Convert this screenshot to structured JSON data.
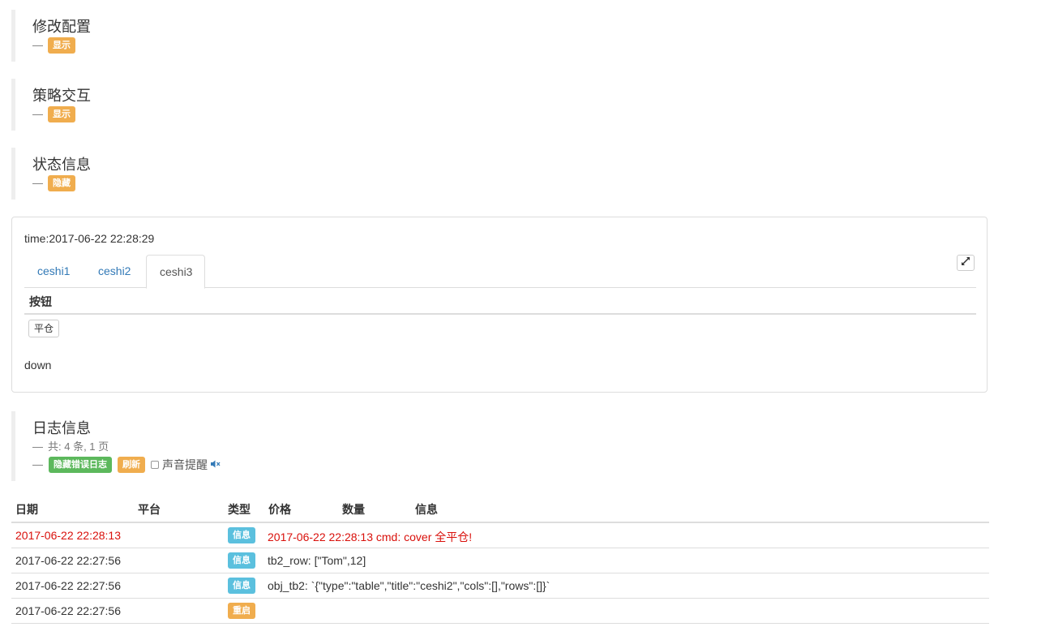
{
  "sections": {
    "modify_config": {
      "title": "修改配置",
      "dash": "—",
      "toggle": "显示"
    },
    "strategy_interaction": {
      "title": "策略交互",
      "dash": "—",
      "toggle": "显示"
    },
    "status_info": {
      "title": "状态信息",
      "dash": "—",
      "toggle": "隐藏"
    }
  },
  "status_panel": {
    "time_text": "time:2017-06-22 22:28:29",
    "tabs": [
      {
        "label": "ceshi1",
        "active": false
      },
      {
        "label": "ceshi2",
        "active": false
      },
      {
        "label": "ceshi3",
        "active": true
      }
    ],
    "table_header": "按钮",
    "button_label": "平仓",
    "footer_text": "down",
    "expand_icon": "expand-icon"
  },
  "log_info": {
    "title": "日志信息",
    "dash": "—",
    "summary": "共: 4 条, 1 页",
    "hide_errors_label": "隐藏错误日志",
    "refresh_label": "刷新",
    "sound_label": "声音提醒",
    "sound_icon": "volume-mute-icon"
  },
  "log_table": {
    "headers": [
      "日期",
      "平台",
      "类型",
      "价格",
      "数量",
      "信息"
    ],
    "rows": [
      {
        "date": "2017-06-22 22:28:13",
        "platform": "",
        "type": "信息",
        "type_style": "info",
        "price": "",
        "amount": "",
        "message": "2017-06-22 22:28:13 cmd: cover 全平仓!",
        "highlight": true
      },
      {
        "date": "2017-06-22 22:27:56",
        "platform": "",
        "type": "信息",
        "type_style": "info",
        "price": "",
        "amount": "",
        "message": "tb2_row: [\"Tom\",12]",
        "highlight": false
      },
      {
        "date": "2017-06-22 22:27:56",
        "platform": "",
        "type": "信息",
        "type_style": "info",
        "price": "",
        "amount": "",
        "message": "obj_tb2: `{\"type\":\"table\",\"title\":\"ceshi2\",\"cols\":[],\"rows\":[]}`",
        "highlight": false
      },
      {
        "date": "2017-06-22 22:27:56",
        "platform": "",
        "type": "重启",
        "type_style": "warning",
        "price": "",
        "amount": "",
        "message": "",
        "highlight": false
      }
    ]
  },
  "colors": {
    "warning": "#f0ad4e",
    "success": "#5cb85c",
    "info": "#5bc0de",
    "link": "#337ab7",
    "error_text": "#d9100b"
  }
}
